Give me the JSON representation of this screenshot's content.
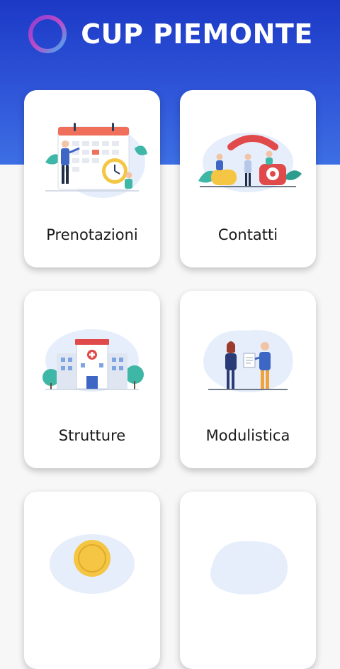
{
  "header": {
    "title": "CUP PIEMONTE",
    "logo": "ring-logo",
    "colors": {
      "gradient_top": "#1c39c6",
      "gradient_bottom": "#3d6fe4"
    }
  },
  "menu": {
    "items": [
      {
        "label": "Prenotazioni",
        "icon": "calendar-illustration"
      },
      {
        "label": "Contatti",
        "icon": "telephone-illustration"
      },
      {
        "label": "Strutture",
        "icon": "hospital-illustration"
      },
      {
        "label": "Modulistica",
        "icon": "documents-illustration"
      },
      {
        "label": "",
        "icon": "coin-illustration"
      },
      {
        "label": "",
        "icon": "blob-illustration"
      }
    ]
  }
}
